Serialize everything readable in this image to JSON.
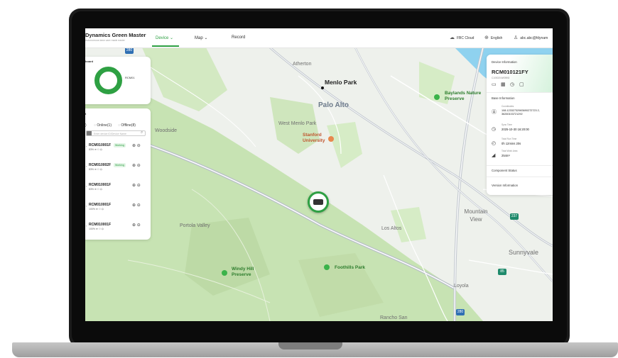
{
  "header": {
    "brand": "Dynamics Green Master",
    "brand_sub": "Autonomous lawn care made easier",
    "nav": [
      {
        "label": "Device ⌄",
        "active": true
      },
      {
        "label": "Map ⌄",
        "active": false
      },
      {
        "label": "Record",
        "active": false
      }
    ],
    "cloud": "FBC Cloud",
    "language": "English",
    "user": "abc.abc@fdynam"
  },
  "dashboard": {
    "title": "board",
    "donut_label": "RCM01"
  },
  "devices": {
    "title": "t",
    "tabs": [
      ")",
      "Online(1)",
      "Offline(8)"
    ],
    "search_placeholder": "Enter device ID/Device Name",
    "items": [
      {
        "name": "RCM010001F",
        "badge": "Working",
        "meta": "83%  ≋  ⚇  ⛭"
      },
      {
        "name": "RCM010002F",
        "badge": "Working",
        "meta": "83%  ≋  ⚇  ⛭"
      },
      {
        "name": "RCM010001F",
        "badge": "",
        "meta": "83%  ≋  ⚇  ⛭"
      },
      {
        "name": "RCM010001F",
        "badge": "",
        "meta": "100%  ≋  ⚇  ⛭"
      },
      {
        "name": "RCM010001F",
        "badge": "",
        "meta": "100%  ≋  ⚇  ⛭"
      }
    ]
  },
  "map": {
    "cities": [
      "Menlo Park",
      "Palo Alto"
    ],
    "towns": [
      "Atherton",
      "West Menlo Park",
      "Woodside",
      "Mountain View",
      "Los Altos",
      "Sunnyvale",
      "Portola Valley",
      "Loyola",
      "Rancho San"
    ],
    "places": [
      "Stanford University"
    ],
    "parks": [
      "Baylands Nature Preserve",
      "Windy Hill Preserve",
      "Foothills Park"
    ],
    "shields": [
      "280",
      "237",
      "85",
      "280"
    ]
  },
  "device_info": {
    "title": "Device Information",
    "device_id": "RCM010121FY",
    "device_sub": "C1000204W09K8",
    "base_title": "Base Information",
    "coord_label": "Coordinates",
    "coord_value": "108.12332732983690272723 2, 36260103721292",
    "sync_label": "Sync Time",
    "sync_value": "2025-10-30 16:20:00",
    "runtime_label": "Total Run Time",
    "runtime_value": "0h 12mins 20s",
    "area_label": "Total Work Area",
    "area_value": "254m²",
    "component_title": "Component Status",
    "version_title": "Version Information"
  },
  "colors": {
    "accent": "#2ea043",
    "park": "#3bb34a",
    "water": "#8fd2ef"
  }
}
